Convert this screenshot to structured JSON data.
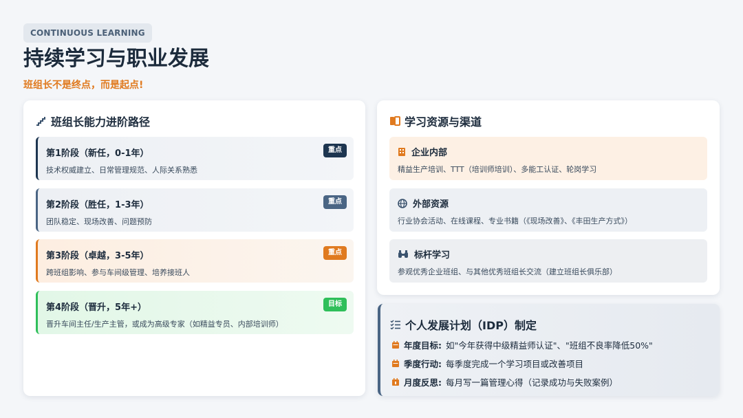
{
  "header": {
    "tag": "CONTINUOUS LEARNING",
    "title": "持续学习与职业发展",
    "subtitle": "班组长不是终点，而是起点!"
  },
  "path_card": {
    "title": "班组长能力进阶路径",
    "stages": [
      {
        "title": "第1阶段（新任，0-1年）",
        "desc": "技术权威建立、日常管理规范、人际关系熟悉",
        "badge": "重点"
      },
      {
        "title": "第2阶段（胜任，1-3年）",
        "desc": "团队稳定、现场改善、问题预防",
        "badge": "重点"
      },
      {
        "title": "第3阶段（卓越，3-5年）",
        "desc": "跨班组影响、参与车间级管理、培养接班人",
        "badge": "重点"
      },
      {
        "title": "第4阶段（晋升，5年+）",
        "desc": "晋升车间主任/生产主管，或成为高级专家（如精益专员、内部培训师）",
        "badge": "目标"
      }
    ]
  },
  "resource_card": {
    "title": "学习资源与渠道",
    "items": [
      {
        "title": "企业内部",
        "desc": "精益生产培训、TTT（培训师培训）、多能工认证、轮岗学习"
      },
      {
        "title": "外部资源",
        "desc": "行业协会活动、在线课程、专业书籍（《现场改善》、《丰田生产方式》）"
      },
      {
        "title": "标杆学习",
        "desc": "参观优秀企业班组、与其他优秀班组长交流（建立班组长俱乐部）"
      }
    ]
  },
  "idp_card": {
    "title": "个人发展计划（IDP）制定",
    "rows": [
      {
        "label": "年度目标:",
        "text": "如\"今年获得中级精益师认证\"、\"班组不良率降低50%\""
      },
      {
        "label": "季度行动:",
        "text": "每季度完成一个学习项目或改善项目"
      },
      {
        "label": "月度反思:",
        "text": "每月写一篇管理心得（记录成功与失败案例）"
      }
    ]
  },
  "colors": {
    "navy": "#1d3550",
    "slate": "#4a6584",
    "orange": "#e07a1f",
    "green": "#2fbf5a"
  }
}
